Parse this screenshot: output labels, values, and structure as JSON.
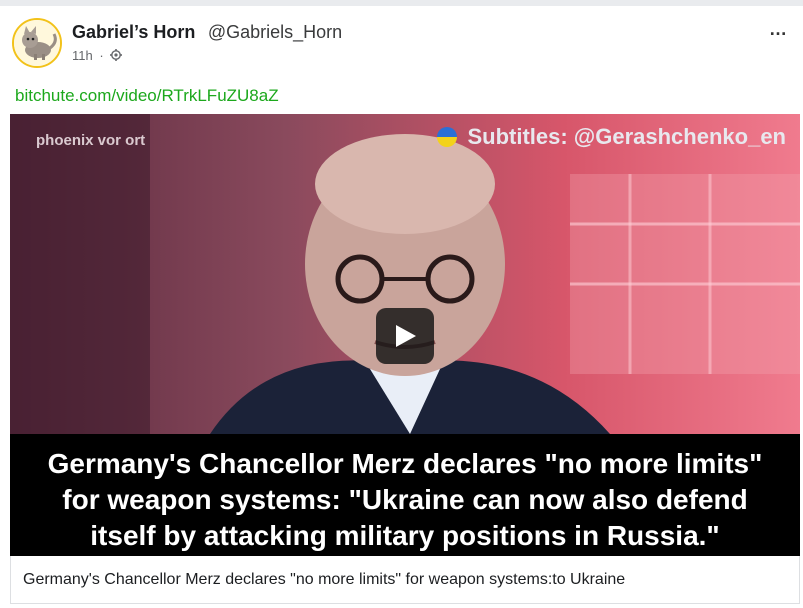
{
  "post": {
    "author_name": "Gabriel’s Horn",
    "author_handle": "@Gabriels_Horn",
    "time": "11h",
    "separator": "·",
    "more_label": "…"
  },
  "link": {
    "text": "bitchute.com/video/RTrkLFuZU8aZ"
  },
  "video": {
    "watermark_left": "phoenix vor ort",
    "watermark_right": "Subtitles: @Gerashchenko_en",
    "subtitle_lines": [
      "Germany's Chancellor Merz declares \"no more limits\"",
      "for weapon systems: \"Ukraine can now also defend",
      "itself by attacking military positions in Russia.\""
    ]
  },
  "caption": {
    "text": "Germany's Chancellor Merz declares \"no more limits\" for weapon systems:to Ukraine"
  },
  "colors": {
    "link": "#1ca81c",
    "accent_ring": "#f2c21a"
  }
}
